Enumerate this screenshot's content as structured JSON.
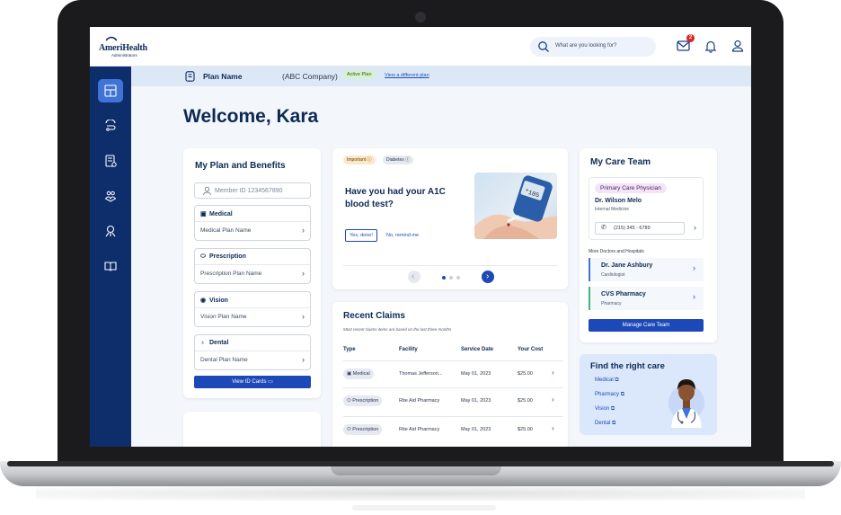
{
  "brand": {
    "name": "AmeriHealth",
    "subtitle": "Administrators",
    "accent": "#1d49b8",
    "navy": "#0d2d6b"
  },
  "header": {
    "search_placeholder": "What are you looking for?",
    "message_badge": "2",
    "icons": [
      "search-icon",
      "mail-icon",
      "bell-icon",
      "user-icon"
    ]
  },
  "sidebar": {
    "items": [
      {
        "icon": "dashboard-icon",
        "active": true
      },
      {
        "icon": "stethoscope-icon",
        "active": false
      },
      {
        "icon": "claims-icon",
        "active": false
      },
      {
        "icon": "care-team-icon",
        "active": false
      },
      {
        "icon": "wellness-icon",
        "active": false
      },
      {
        "icon": "library-icon",
        "active": false
      }
    ]
  },
  "plan_bar": {
    "plan_name": "Plan Name",
    "company": "(ABC Company)",
    "status": "Active Plan",
    "switch_link": "View a different plan"
  },
  "welcome": "Welcome, Kara",
  "plan_card": {
    "title": "My Plan and Benefits",
    "member_id": "Member ID 1234567890",
    "benefits": [
      {
        "title": "Medical",
        "icon": "medical-kit-icon",
        "plan": "Medical Plan Name"
      },
      {
        "title": "Prescription",
        "icon": "pill-icon",
        "plan": "Prescription Plan Name"
      },
      {
        "title": "Vision",
        "icon": "eye-icon",
        "plan": "Vision Plan Name"
      },
      {
        "title": "Dental",
        "icon": "tooth-icon",
        "plan": "Dental Plan Name"
      }
    ],
    "id_cards_button": "View ID Cards"
  },
  "a1c_card": {
    "tags": [
      "Important",
      "Diabetes"
    ],
    "question": "Have you had your A1C blood test?",
    "yes_button": "Yes, done!",
    "no_button": "No, remind me",
    "image_reading": "*105",
    "carousel": {
      "pages": 3,
      "current": 1
    }
  },
  "claims": {
    "title": "Recent Claims",
    "subtitle": "Most recent claims items are based on the last three months",
    "columns": [
      "Type",
      "Facility",
      "Service Date",
      "Your Cost"
    ],
    "rows": [
      {
        "type": "Medical",
        "facility": "Thomas Jefferson...",
        "date": "May 01, 2023",
        "cost": "$25.00"
      },
      {
        "type": "Prescription",
        "facility": "Rite Aid Pharmacy",
        "date": "May 01, 2023",
        "cost": "$25.00"
      },
      {
        "type": "Prescription",
        "facility": "Rite Aid Pharmacy",
        "date": "May 01, 2023",
        "cost": "$25.00"
      }
    ]
  },
  "care_team": {
    "title": "My Care Team",
    "pcp_label": "Primary Care Physician",
    "pcp_name": "Dr. Wilson Melo",
    "pcp_specialty": "Internal Medicine",
    "pcp_phone": "(215) 345 - 6789",
    "more_label": "More Doctors and Hospitals",
    "providers": [
      {
        "name": "Dr. Jane Ashbury",
        "type": "Cardiologist",
        "color": "#3f74d6"
      },
      {
        "name": "CVS Pharmacy",
        "type": "Pharmacy",
        "color": "#3fb87a"
      }
    ],
    "manage_button": "Manage Care Team"
  },
  "find_care": {
    "title": "Find the right care",
    "links": [
      "Medical",
      "Pharmacy",
      "Vision",
      "Dental"
    ]
  }
}
